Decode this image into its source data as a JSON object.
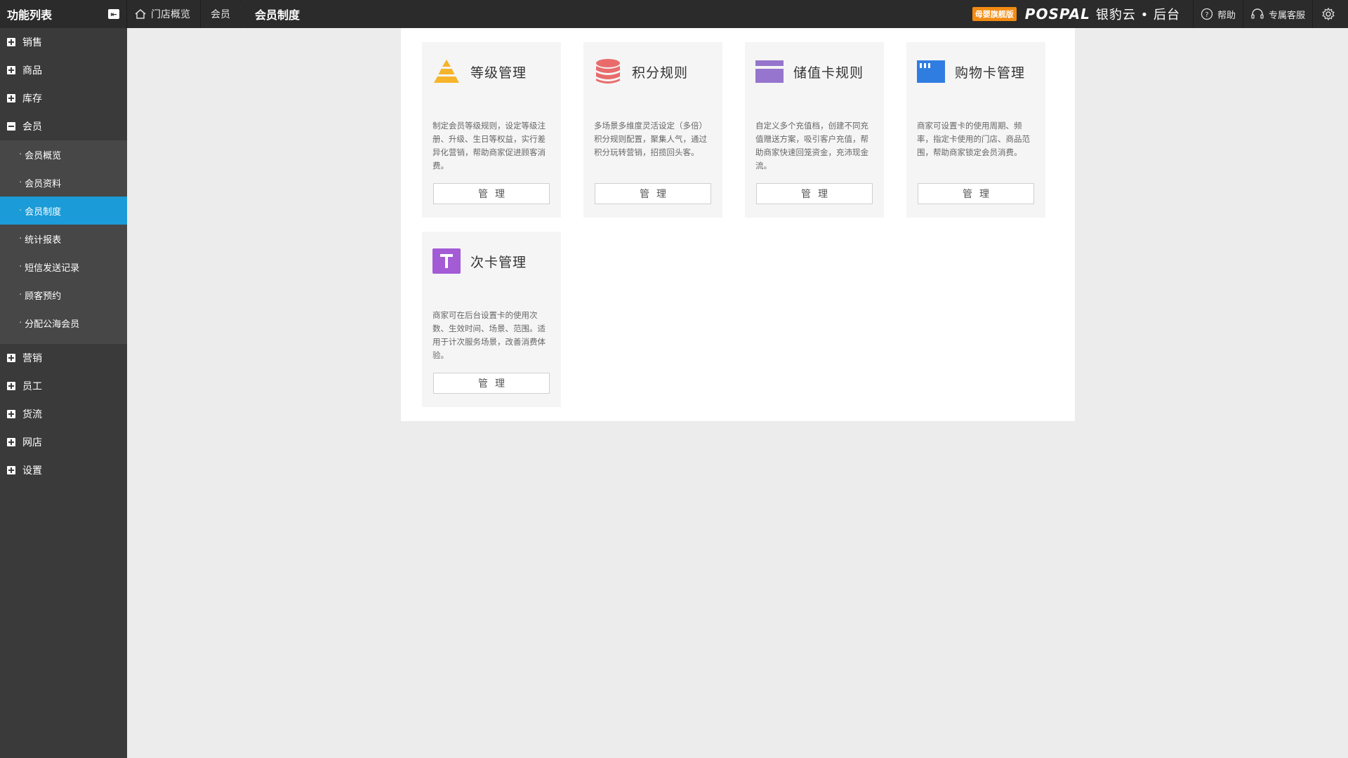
{
  "topbar": {
    "brand_title": "功能列表",
    "collapse_icon": "arrow-left-icon",
    "breadcrumb": {
      "home": "门店概览",
      "parent": "会员",
      "current": "会员制度"
    },
    "badge": "母婴旗舰版",
    "logo_text": "POSPAL",
    "logo_cn": "银豹云 • 后台",
    "help_label": "帮助",
    "service_label": "专属客服"
  },
  "sidebar": {
    "groups_top": [
      {
        "label": "销售",
        "expanded": false
      },
      {
        "label": "商品",
        "expanded": false
      },
      {
        "label": "库存",
        "expanded": false
      },
      {
        "label": "会员",
        "expanded": true
      }
    ],
    "sub_items": [
      {
        "label": "会员概览",
        "active": false
      },
      {
        "label": "会员资料",
        "active": false
      },
      {
        "label": "会员制度",
        "active": true
      },
      {
        "label": "统计报表",
        "active": false
      },
      {
        "label": "短信发送记录",
        "active": false
      },
      {
        "label": "顾客预约",
        "active": false
      },
      {
        "label": "分配公海会员",
        "active": false
      }
    ],
    "groups_bottom": [
      {
        "label": "营销",
        "expanded": false
      },
      {
        "label": "员工",
        "expanded": false
      },
      {
        "label": "货流",
        "expanded": false
      },
      {
        "label": "网店",
        "expanded": false
      },
      {
        "label": "设置",
        "expanded": false
      }
    ]
  },
  "cards": [
    {
      "title": "等级管理",
      "icon": "pyramid-icon",
      "color": "#f5b42a",
      "desc": "制定会员等级规则，设定等级注册、升级、生日等权益，实行差异化营销，帮助商家促进顾客消费。",
      "button": "管理"
    },
    {
      "title": "积分规则",
      "icon": "coin-stack-icon",
      "color": "#e96b6b",
      "desc": "多场景多维度灵活设定（多倍）积分规则配置，聚集人气，通过积分玩转营销，招揽回头客。",
      "button": "管理"
    },
    {
      "title": "储值卡规则",
      "icon": "card-icon",
      "color": "#9575cd",
      "desc": "自定义多个充值档，创建不同充值赠送方案，吸引客户充值，帮助商家快速回笼资金，充沛现金流。",
      "button": "管理"
    },
    {
      "title": "购物卡管理",
      "icon": "shopping-card-icon",
      "color": "#2f7de1",
      "desc": "商家可设置卡的使用周期、频率，指定卡使用的门店、商品范围，帮助商家锁定会员消费。",
      "button": "管理"
    },
    {
      "title": "次卡管理",
      "icon": "t-card-icon",
      "color": "#a35bd6",
      "desc": "商家可在后台设置卡的使用次数、生效时间、场景、范围。适用于计次服务场景，改善消费体验。",
      "button": "管理"
    }
  ]
}
